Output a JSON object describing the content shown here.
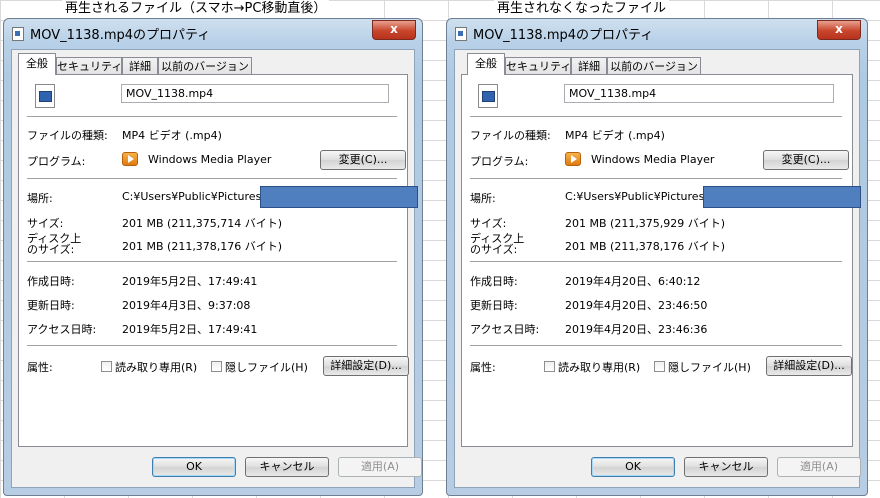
{
  "captions": {
    "left": "再生されるファイル（スマホ→PC移動直後）",
    "right": "再生されなくなったファイル"
  },
  "tabs": [
    "全般",
    "セキュリティ",
    "詳細",
    "以前のバージョン"
  ],
  "labels": {
    "file_type": "ファイルの種類:",
    "program": "プログラム:",
    "location": "場所:",
    "size": "サイズ:",
    "size_on_disk_1": "ディスク上",
    "size_on_disk_2": "のサイズ:",
    "created": "作成日時:",
    "modified": "更新日時:",
    "accessed": "アクセス日時:",
    "attributes": "属性:",
    "readonly": "読み取り専用(R)",
    "hidden": "隠しファイル(H)"
  },
  "buttons": {
    "change": "変更(C)...",
    "advanced": "詳細設定(D)...",
    "ok": "OK",
    "cancel": "キャンセル",
    "apply": "適用(A)",
    "close": "x"
  },
  "icons": {
    "title": "properties-window-icon",
    "file": "video-file-icon",
    "program": "windows-media-player-icon"
  },
  "colors": {
    "redaction": "#4f7fbf",
    "close": "#c8452c"
  },
  "dialogs": [
    {
      "title": "MOV_1138.mp4のプロパティ",
      "file_name": "MOV_1138.mp4",
      "file_type": "MP4 ビデオ (.mp4)",
      "program": "Windows Media Player",
      "location": "C:¥Users¥Public¥Pictures¥",
      "size": "201 MB (211,375,714 バイト)",
      "size_on_disk": "201 MB (211,378,176 バイト)",
      "created": "2019年5月2日、17:49:41",
      "modified": "2019年4月3日、9:37:08",
      "accessed": "2019年5月2日、17:49:41"
    },
    {
      "title": "MOV_1138.mp4のプロパティ",
      "file_name": "MOV_1138.mp4",
      "file_type": "MP4 ビデオ (.mp4)",
      "program": "Windows Media Player",
      "location": "C:¥Users¥Public¥Pictures¥",
      "size": "201 MB (211,375,929 バイト)",
      "size_on_disk": "201 MB (211,378,176 バイト)",
      "created": "2019年4月20日、6:40:12",
      "modified": "2019年4月20日、23:46:50",
      "accessed": "2019年4月20日、23:46:36"
    }
  ]
}
